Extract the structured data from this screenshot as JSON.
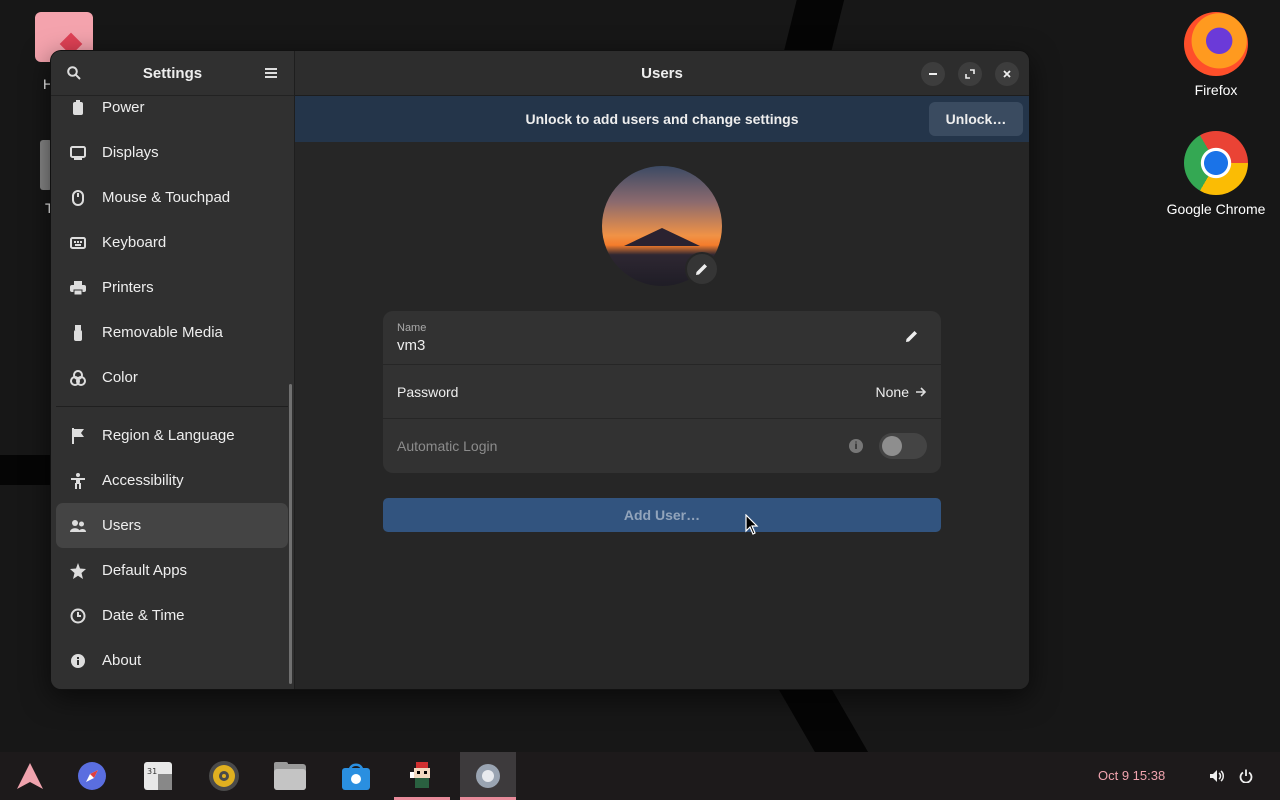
{
  "desktop": {
    "icons": [
      {
        "label": "Firefox"
      },
      {
        "label": "Google Chrome"
      }
    ],
    "partial_labels": {
      "home": "H",
      "trash": "T"
    }
  },
  "window": {
    "sidebar": {
      "title": "Settings",
      "items": [
        {
          "label": "Power",
          "icon": "power-icon"
        },
        {
          "label": "Displays",
          "icon": "display-icon"
        },
        {
          "label": "Mouse & Touchpad",
          "icon": "mouse-icon"
        },
        {
          "label": "Keyboard",
          "icon": "keyboard-icon"
        },
        {
          "label": "Printers",
          "icon": "printer-icon"
        },
        {
          "label": "Removable Media",
          "icon": "usb-icon"
        },
        {
          "label": "Color",
          "icon": "color-icon"
        },
        {
          "label": "Region & Language",
          "icon": "flag-icon"
        },
        {
          "label": "Accessibility",
          "icon": "accessibility-icon"
        },
        {
          "label": "Users",
          "icon": "users-icon",
          "active": true
        },
        {
          "label": "Default Apps",
          "icon": "star-icon"
        },
        {
          "label": "Date & Time",
          "icon": "clock-icon"
        },
        {
          "label": "About",
          "icon": "info-icon"
        }
      ]
    },
    "header": {
      "title": "Users"
    },
    "infobar": {
      "message": "Unlock to add users and change settings",
      "button": "Unlock…"
    },
    "user": {
      "name_label": "Name",
      "name_value": "vm3",
      "password_label": "Password",
      "password_value": "None",
      "autologin_label": "Automatic Login",
      "autologin_enabled": false
    },
    "add_user_button": "Add User…"
  },
  "taskbar": {
    "apps": [
      "arch-menu-icon",
      "web-browser-icon",
      "calendar-icon",
      "music-icon",
      "files-icon",
      "software-store-icon",
      "game-icon",
      "settings-icon"
    ],
    "clock": "Oct 9  15:38",
    "accent": "#e88a9a"
  }
}
